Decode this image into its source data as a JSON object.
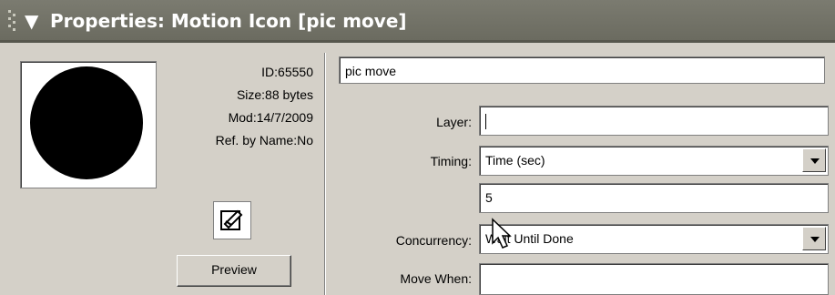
{
  "titlebar": {
    "collapse_icon": "triangle-down-icon",
    "title": "Properties: Motion Icon [pic move]"
  },
  "icon_info": {
    "id": "ID:65550",
    "size": "Size:88 bytes",
    "mod": "Mod:14/7/2009",
    "ref": "Ref. by Name:No"
  },
  "preview_label": "Preview",
  "name_value": "pic move",
  "fields": {
    "layer_label": "Layer:",
    "layer_value": "",
    "timing_label": "Timing:",
    "timing_value": "Time (sec)",
    "duration_value": "5",
    "concurrency_label": "Concurrency:",
    "concurrency_value": "Wait Until Done",
    "move_when_label": "Move When:",
    "move_when_value": ""
  },
  "colors": {
    "titlebar": "#6f6f64",
    "panel": "#d4d0c8",
    "title_text": "#ffffff"
  }
}
